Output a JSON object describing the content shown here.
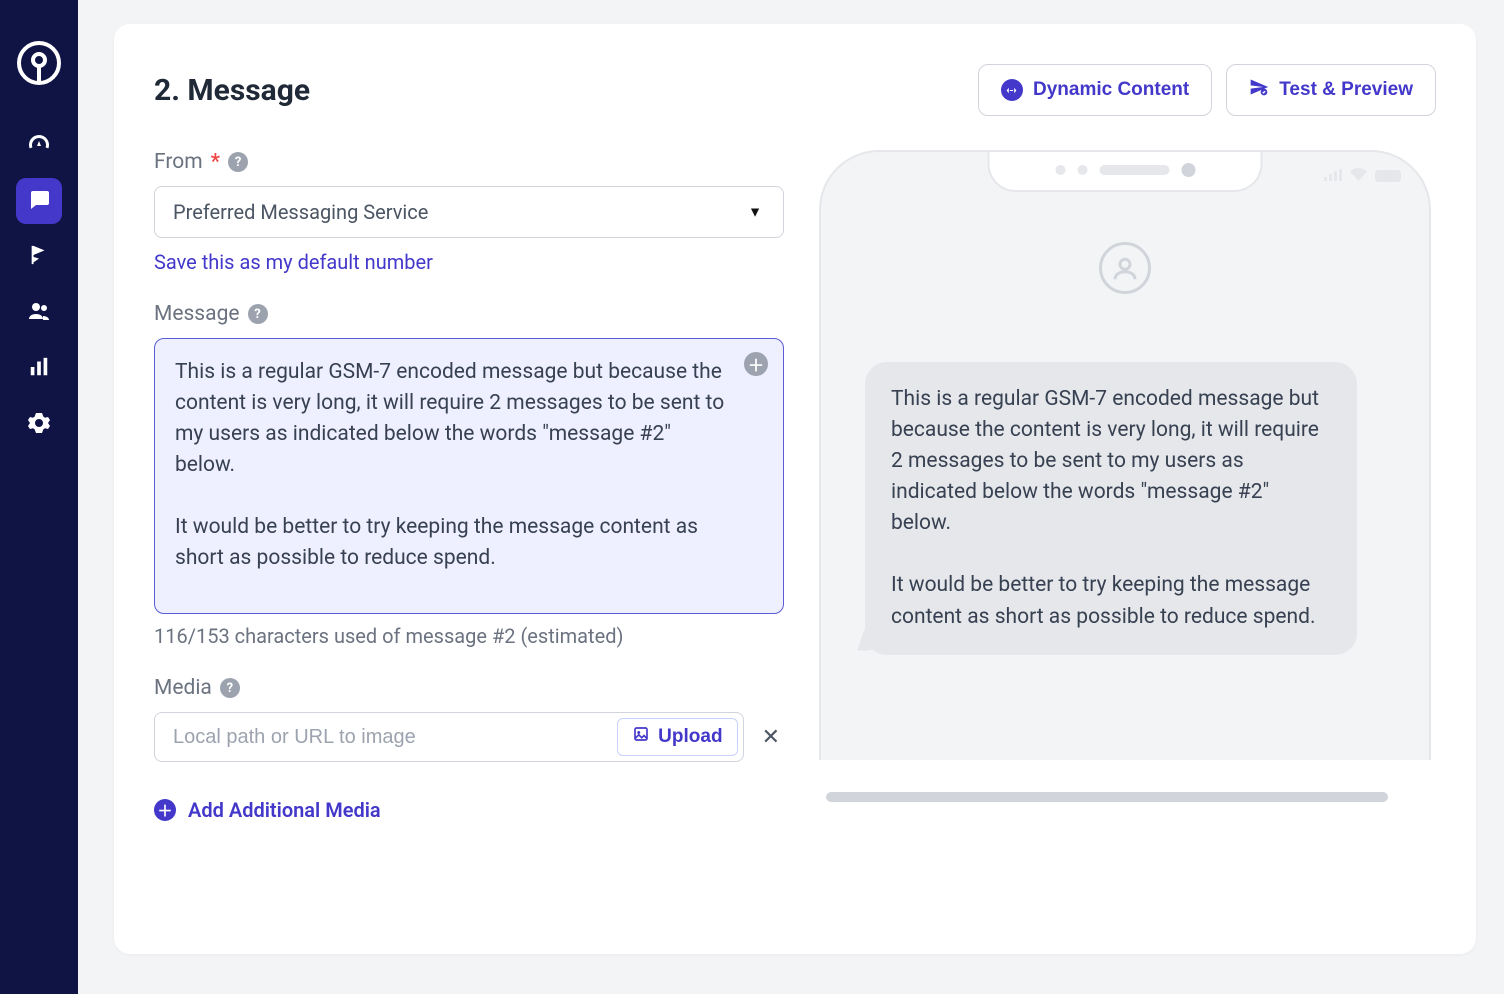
{
  "section": {
    "title": "2. Message"
  },
  "header_buttons": {
    "dynamic_content": "Dynamic Content",
    "test_preview": "Test & Preview"
  },
  "from_field": {
    "label": "From",
    "required_star": "*",
    "selected_value": "Preferred Messaging Service",
    "save_default_link": "Save this as my default number"
  },
  "message_field": {
    "label": "Message",
    "text": "This is a regular GSM-7 encoded message but because the content is very long, it will require 2 messages to be sent to my users as indicated below the words \"message #2\" below.\n\nIt would be better to try keeping the message content as short as possible to reduce spend.",
    "char_count_line": "116/153 characters used of message #2 (estimated)"
  },
  "media_field": {
    "label": "Media",
    "placeholder": "Local path or URL to image",
    "upload_label": "Upload"
  },
  "add_media_label": "Add Additional Media",
  "preview_bubble_text": "This is a regular GSM-7 encoded message but because the content is very long, it will require 2 messages to be sent to my users as indicated below the words \"message #2\" below.\n\nIt would be better to try keeping the message content as short as possible to reduce spend.",
  "sidebar": {
    "icons": [
      "dashboard-gauge-icon",
      "message-icon",
      "flag-icon",
      "people-icon",
      "bar-chart-icon",
      "gear-icon"
    ]
  }
}
